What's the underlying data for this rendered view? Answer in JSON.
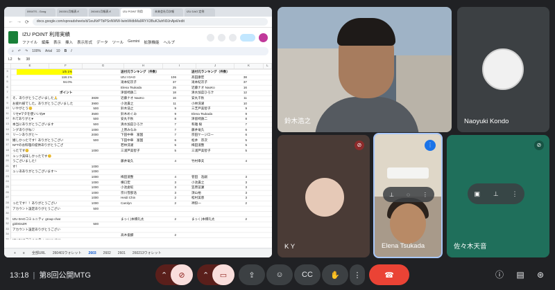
{
  "browser": {
    "tabs": [
      "0904TS - Goog",
      "260301月報表メ",
      "260401月報表メ",
      "IZU POINT 利用",
      "未来会社月次報",
      "IZU DAO 定例"
    ],
    "url": "docs.google.com/spreadsheets/d/1euNrPTbPSnNWW-IwiniWdbMa9RYX3BuK3uhN9JnAjeil/edit"
  },
  "sheet": {
    "title": "IZU POINT 利用実績",
    "menus": [
      "ファイル",
      "編集",
      "表示",
      "挿入",
      "表示形式",
      "データ",
      "ツール",
      "Gemini",
      "拡張機能",
      "ヘルプ"
    ],
    "toolbar": {
      "zoom": "100%",
      "font": "Arial",
      "size": "10"
    },
    "cell_ref": "L2",
    "formula": "38",
    "yellow_cell": "1/5 1%",
    "pct1": "118.1%",
    "pct2": "94.0%",
    "points_header": "ポイント",
    "rank_header_1": "送付元ランキング（件数）",
    "rank_header_2": "送付元ランキング（件数）",
    "rows_left": [
      {
        "text": "そ、ありがとうございました🙏",
        "value": "3839"
      },
      {
        "text": "お疲れ様でした。ありがとうございました",
        "value": "3900"
      },
      {
        "text": "いやがとう😊",
        "value": "500"
      },
      {
        "text": "リセ♥マタを使いいね♥",
        "value": "3500"
      },
      {
        "text": "れてありがと♥",
        "value": "500"
      },
      {
        "text": "本当にありがとうございます",
        "value": "500"
      },
      {
        "text": "ングありがね♡",
        "value": "1000"
      },
      {
        "text": "リーンありがと〜",
        "value": "2000"
      },
      {
        "text": "嬉しかったです！ありがとうござい",
        "value": "500"
      },
      {
        "text": "NFTのお料理の提供ありがとうござ",
        "value": ""
      },
      {
        "text": "ったです😊",
        "value": "1000"
      },
      {
        "text": "ュック美味しかったです😊",
        "value": ""
      },
      {
        "text": "うございました！",
        "value": ""
      },
      {
        "text": "す！",
        "value": "1000"
      },
      {
        "text": "ュッあありがとうございます～",
        "value": "1000"
      },
      {
        "text": "",
        "value": "1000"
      },
      {
        "text": "",
        "value": "1000"
      },
      {
        "text": "",
        "value": "1000"
      },
      {
        "text": "",
        "value": "1000"
      },
      {
        "text": "",
        "value": "1000"
      },
      {
        "text": "ったです！！ありがとうござい",
        "value": "1000"
      },
      {
        "text": "アカウント設定ありがとうござい",
        "value": "500"
      },
      {
        "text": "",
        "value": ""
      },
      {
        "text": "IZU DAOコミュニティ group chat",
        "value": ""
      },
      {
        "text": "git/0GsZR",
        "value": "500"
      },
      {
        "text": "アカウント設定ありがとうござい",
        "value": ""
      },
      {
        "text": "",
        "value": ""
      },
      {
        "text": "IZU DAOコミュニティ group chat",
        "value": ""
      },
      {
        "text": "git/0GsZR",
        "value": "500"
      },
      {
        "text": "アカウント設定ありがとうござい",
        "value": ""
      }
    ],
    "ranking1": [
      {
        "name": "IZU:I DAO",
        "count": "106"
      },
      {
        "name": "滝本紀次子",
        "count": "37"
      },
      {
        "name": "Elena Tsukada",
        "count": "25"
      },
      {
        "name": "津留崎鉄二",
        "count": "18"
      },
      {
        "name": "近藤ナオ NaoKo",
        "count": "16"
      },
      {
        "name": "小池貴之",
        "count": "11"
      },
      {
        "name": "鈴木浩之",
        "count": "9"
      },
      {
        "name": "鈴木めぐみ",
        "count": "9"
      },
      {
        "name": "安丸千秋",
        "count": "8"
      },
      {
        "name": "清水加菜ひろ汁",
        "count": "7"
      },
      {
        "name": "上原みなみ",
        "count": "7"
      },
      {
        "name": "下田中華　富国",
        "count": "7"
      },
      {
        "name": "下田中華　富国",
        "count": "6"
      },
      {
        "name": "若林洗濯",
        "count": "5"
      },
      {
        "name": "三浦芦美智子",
        "count": "5"
      },
      {
        "name": "",
        "count": ""
      },
      {
        "name": "藤井竜久",
        "count": "4"
      },
      {
        "name": "",
        "count": ""
      },
      {
        "name": "",
        "count": ""
      },
      {
        "name": "梅田道整",
        "count": "4"
      },
      {
        "name": "横口宏",
        "count": "3"
      },
      {
        "name": "小池倉蛇",
        "count": "3"
      },
      {
        "name": "宗川雪部浩",
        "count": "3"
      },
      {
        "name": "Heidi Chin",
        "count": "2"
      },
      {
        "name": "Carolyn",
        "count": "2"
      },
      {
        "name": "",
        "count": ""
      },
      {
        "name": "",
        "count": ""
      },
      {
        "name": "まっく(本橋礼太",
        "count": "2"
      },
      {
        "name": "",
        "count": ""
      },
      {
        "name": "",
        "count": ""
      },
      {
        "name": "高木俊麟",
        "count": "2"
      }
    ],
    "ranking2": [
      {
        "name": "髙田康宏",
        "count": "38"
      },
      {
        "name": "滝本紀次子",
        "count": "37"
      },
      {
        "name": "近藤ナオ NaoKo",
        "count": "16"
      },
      {
        "name": "清水加菜ひろ汁",
        "count": "12"
      },
      {
        "name": "安丸千秋",
        "count": "11"
      },
      {
        "name": "小林洗濯",
        "count": "10"
      },
      {
        "name": "三芝戸美智子",
        "count": "9"
      },
      {
        "name": "Elena Tsukada",
        "count": "9"
      },
      {
        "name": "津留崎鉄二",
        "count": "8"
      },
      {
        "name": "和雅 樹",
        "count": "7"
      },
      {
        "name": "藤井竜久",
        "count": "6"
      },
      {
        "name": "宗田ケージロー",
        "count": "6"
      },
      {
        "name": "松井　宗次",
        "count": "5"
      },
      {
        "name": "梅田道整",
        "count": "5"
      },
      {
        "name": "三浦芦美智子",
        "count": "5"
      },
      {
        "name": "",
        "count": ""
      },
      {
        "name": "竹村幸夫",
        "count": "4"
      },
      {
        "name": "",
        "count": ""
      },
      {
        "name": "",
        "count": ""
      },
      {
        "name": "菅田　浩嗣",
        "count": "3"
      },
      {
        "name": "小池貴之",
        "count": "3"
      },
      {
        "name": "笠原菜瀬",
        "count": "3"
      },
      {
        "name": "須山裕",
        "count": "3"
      },
      {
        "name": "松村美恵",
        "count": "3"
      },
      {
        "name": "神狩一",
        "count": "2"
      },
      {
        "name": "",
        "count": ""
      },
      {
        "name": "",
        "count": ""
      },
      {
        "name": "まっく(本橋礼太",
        "count": "2"
      },
      {
        "name": "",
        "count": ""
      },
      {
        "name": "",
        "count": ""
      },
      {
        "name": "",
        "count": ""
      }
    ],
    "tabs": [
      "全部URL",
      "260401ウォレット",
      "2603",
      "2602",
      "2601",
      "260213ウォレット"
    ],
    "active_tab": "2603"
  },
  "participants": {
    "main": "鈴木浩之",
    "kondo": "Naoyuki Kondo",
    "ky": "K Y",
    "elena": "Elena Tsukada",
    "sasaki": "佐々木天音"
  },
  "meeting": {
    "time": "13:18",
    "title": "第8回公開MTG"
  },
  "icons": {
    "mic_off": "mic-off-icon",
    "cam_off": "camera-off-icon",
    "present": "present-icon",
    "emoji": "emoji-icon",
    "captions": "captions-icon",
    "hand": "raise-hand-icon",
    "more": "more-options-icon",
    "end": "end-call-icon",
    "info": "info-icon",
    "chat": "chat-icon",
    "people": "people-icon"
  },
  "colors": {
    "end_call": "#ea4335",
    "speaking_blue": "#1a73e8",
    "muted_chip": "#f9dedc"
  }
}
